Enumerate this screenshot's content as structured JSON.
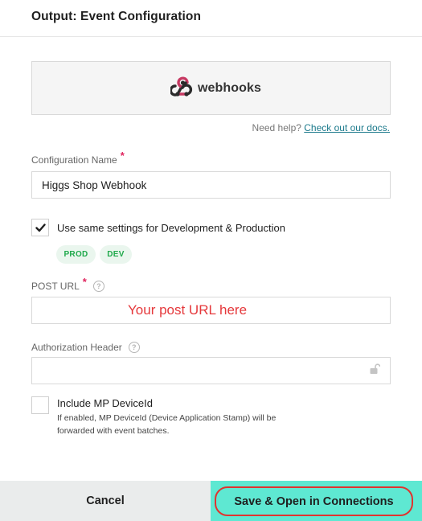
{
  "header": {
    "title": "Output: Event Configuration"
  },
  "logo": {
    "text": "webhooks",
    "icon": "webhooks-logo-icon",
    "color": "#c73a63"
  },
  "help": {
    "prefix": "Need help?",
    "link": "Check out our docs."
  },
  "config_name": {
    "label": "Configuration Name",
    "required_mark": "*",
    "value": "Higgs Shop Webhook"
  },
  "same_settings": {
    "checked": true,
    "label": "Use same settings for Development & Production"
  },
  "env_pills": [
    "PROD",
    "DEV"
  ],
  "post_url": {
    "label": "POST URL",
    "required_mark": "*",
    "help_icon": "?",
    "annotation": "Your post URL here",
    "value": ""
  },
  "auth_header": {
    "label": "Authorization Header",
    "help_icon": "?",
    "value": "",
    "icon": "lock-icon"
  },
  "device_id": {
    "checked": false,
    "label": "Include MP DeviceId",
    "description": "If enabled, MP DeviceId (Device Application Stamp) will be forwarded with event batches."
  },
  "footer": {
    "cancel_label": "Cancel",
    "save_label": "Save & Open in Connections"
  },
  "colors": {
    "accent": "#5ee8d2",
    "required": "#e0245e",
    "pill_text": "#1fa94b",
    "annotation": "#e5383b",
    "highlight_border": "#e0332f",
    "link": "#1c7a8c"
  }
}
